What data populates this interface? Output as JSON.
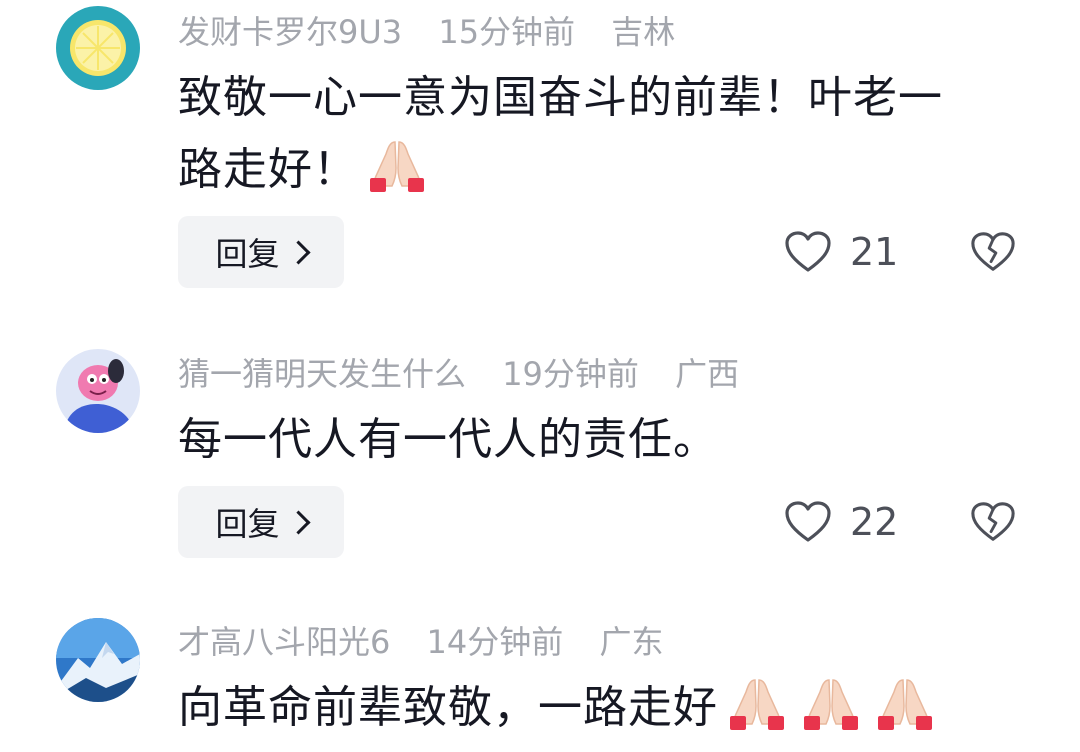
{
  "comments": [
    {
      "username": "发财卡罗尔9U3",
      "time": "15分钟前",
      "location": "吉林",
      "text_line1": "致敬一心一意为国奋斗的前辈！叶老一",
      "text_line2": "路走好！",
      "emoji_count": 1,
      "reply_label": "回复",
      "likes": "21"
    },
    {
      "username": "猜一猜明天发生什么",
      "time": "19分钟前",
      "location": "广西",
      "text_line1": "每一代人有一代人的责任。",
      "reply_label": "回复",
      "likes": "22"
    },
    {
      "username": "才高八斗阳光6",
      "time": "14分钟前",
      "location": "广东",
      "text_line1": "向革命前辈致敬，一路走好",
      "emoji_count": 3
    }
  ],
  "icons": {
    "like": "heart-outline-icon",
    "dislike": "broken-heart-icon",
    "emoji": "folded-hands-emoji"
  },
  "colors": {
    "meta": "#a3a6ad",
    "text": "#161823",
    "button_bg": "#f2f3f5"
  }
}
